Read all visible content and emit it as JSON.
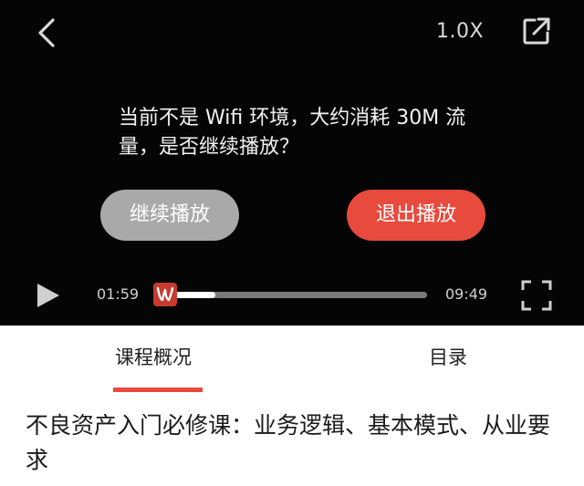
{
  "player": {
    "speed": "1.0X",
    "prompt": "当前不是 Wifi 环境，大约消耗 30M 流量，是否继续播放？",
    "continue_label": "继续播放",
    "exit_label": "退出播放",
    "current_time": "01:59",
    "total_time": "09:49",
    "progress": 0.2,
    "icons": [
      "back-icon",
      "share-icon",
      "play-icon",
      "fullscreen-icon"
    ]
  },
  "tabs": [
    {
      "label": "课程概况",
      "active": true
    },
    {
      "label": "目录",
      "active": false
    }
  ],
  "course": {
    "title": "不良资产入门必修课：业务逻辑、基本模式、从业要求"
  },
  "colors": {
    "accent": "#e84a3e",
    "player_bg": "#050505",
    "secondary_button": "#a9a9a9"
  }
}
